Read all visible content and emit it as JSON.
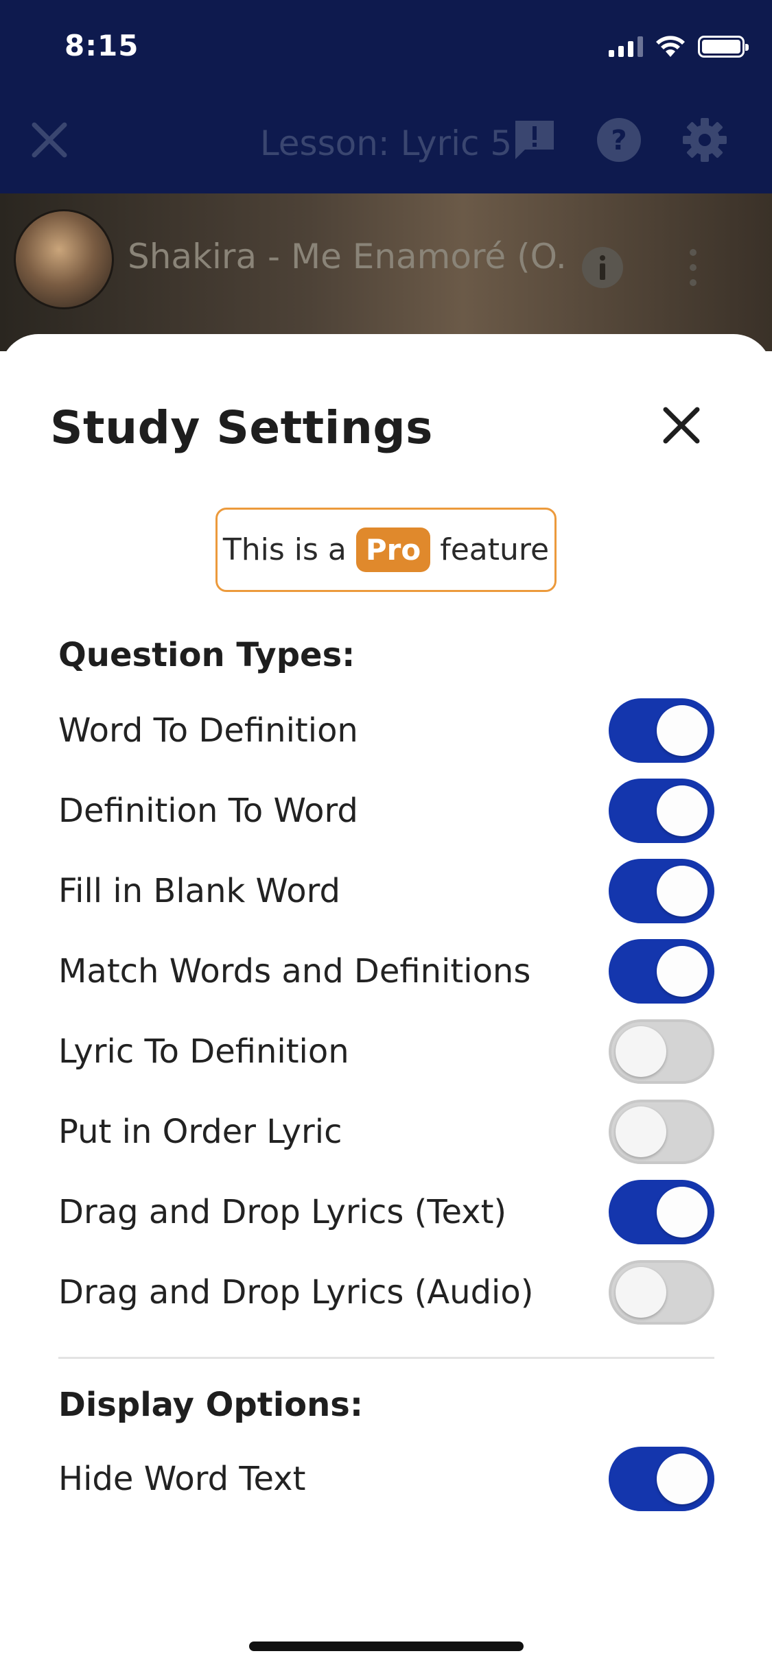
{
  "status_bar": {
    "time": "8:15"
  },
  "nav": {
    "title": "Lesson: Lyric 5"
  },
  "video": {
    "title": "Shakira - Me Enamoré (O..."
  },
  "sheet": {
    "title": "Study Settings",
    "pro_notice": {
      "prefix": "This is a",
      "badge": "Pro",
      "suffix": "feature"
    },
    "question_types": {
      "header": "Question Types:",
      "items": [
        {
          "label": "Word To Definition",
          "enabled": true
        },
        {
          "label": "Definition To Word",
          "enabled": true
        },
        {
          "label": "Fill in Blank Word",
          "enabled": true
        },
        {
          "label": "Match Words and Definitions",
          "enabled": true
        },
        {
          "label": "Lyric To Definition",
          "enabled": false
        },
        {
          "label": "Put in Order Lyric",
          "enabled": false
        },
        {
          "label": "Drag and Drop Lyrics (Text)",
          "enabled": true
        },
        {
          "label": "Drag and Drop Lyrics (Audio)",
          "enabled": false
        }
      ]
    },
    "display_options": {
      "header": "Display Options:",
      "items": [
        {
          "label": "Hide Word Text",
          "enabled": true
        }
      ]
    }
  },
  "colors": {
    "accent": "#1436ad",
    "header_bg": "#0e1a4e",
    "pro_orange": "#e0892c"
  }
}
